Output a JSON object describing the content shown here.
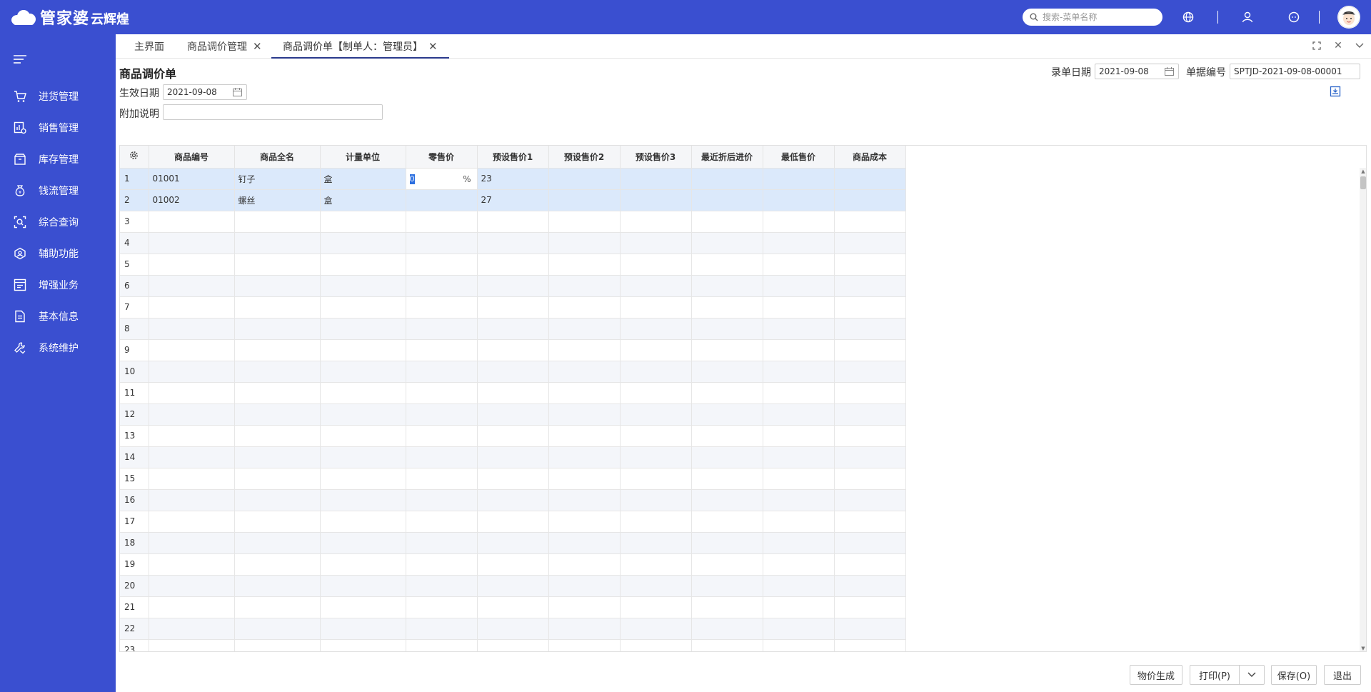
{
  "brand": {
    "name": "管家婆",
    "product": "云辉煌"
  },
  "search": {
    "placeholder": "搜索-菜单名称"
  },
  "sidebar": {
    "items": [
      {
        "label": "进货管理",
        "icon": "cart-icon"
      },
      {
        "label": "销售管理",
        "icon": "sales-chart-icon"
      },
      {
        "label": "库存管理",
        "icon": "box-icon"
      },
      {
        "label": "钱流管理",
        "icon": "money-bag-icon"
      },
      {
        "label": "综合查询",
        "icon": "search-scan-icon"
      },
      {
        "label": "辅助功能",
        "icon": "hexagon-icon"
      },
      {
        "label": "增强业务",
        "icon": "list-panel-icon"
      },
      {
        "label": "基本信息",
        "icon": "document-icon"
      },
      {
        "label": "系统维护",
        "icon": "wrench-icon"
      }
    ]
  },
  "tabs": [
    {
      "label": "主界面",
      "closable": false
    },
    {
      "label": "商品调价管理",
      "closable": true
    },
    {
      "label": "商品调价单【制单人：管理员】",
      "closable": true,
      "active": true
    }
  ],
  "form": {
    "title": "商品调价单",
    "entry_date_label": "录单日期",
    "entry_date": "2021-09-08",
    "bill_no_label": "单据编号",
    "bill_no": "SPTJD-2021-09-08-00001",
    "effective_date_label": "生效日期",
    "effective_date": "2021-09-08",
    "note_label": "附加说明",
    "note": ""
  },
  "grid": {
    "columns": [
      "商品编号",
      "商品全名",
      "计量单位",
      "零售价",
      "预设售价1",
      "预设售价2",
      "预设售价3",
      "最近折后进价",
      "最低售价",
      "商品成本"
    ],
    "rows": [
      [
        "01001",
        "钉子",
        "盒",
        "0",
        "23",
        "",
        "",
        "",
        "",
        ""
      ],
      [
        "01002",
        "螺丝",
        "盒",
        "",
        "27",
        "",
        "",
        "",
        "",
        ""
      ]
    ],
    "row_numbers": [
      "1",
      "2",
      "3",
      "4",
      "5",
      "6",
      "7",
      "8",
      "9",
      "10",
      "11",
      "12",
      "13",
      "14",
      "15",
      "16",
      "17",
      "18",
      "19",
      "20",
      "21",
      "22",
      "23"
    ],
    "pct_symbol": "%"
  },
  "buttons": {
    "price_gen": "物价生成",
    "print": "打印(P)",
    "save": "保存(O)",
    "exit": "退出"
  }
}
